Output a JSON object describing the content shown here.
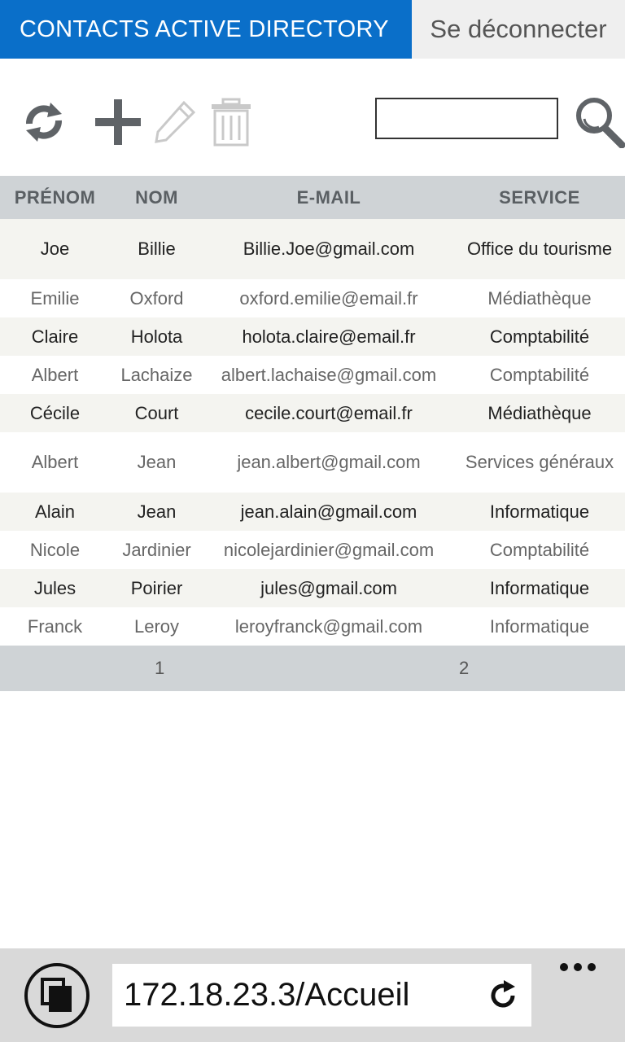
{
  "header": {
    "title": "CONTACTS ACTIVE DIRECTORY",
    "logout": "Se déconnecter"
  },
  "toolbar": {
    "search_placeholder": ""
  },
  "table": {
    "columns": [
      "PRÉNOM",
      "NOM",
      "E-MAIL",
      "SERVICE"
    ],
    "rows": [
      [
        "Joe",
        "Billie",
        "Billie.Joe@gmail.com",
        "Office du tourisme"
      ],
      [
        "Emilie",
        "Oxford",
        "oxford.emilie@email.fr",
        "Médiathèque"
      ],
      [
        "Claire",
        "Holota",
        "holota.claire@email.fr",
        "Comptabilité"
      ],
      [
        "Albert",
        "Lachaize",
        "albert.lachaise@gmail.com",
        "Comptabilité"
      ],
      [
        "Cécile",
        "Court",
        "cecile.court@email.fr",
        "Médiathèque"
      ],
      [
        "Albert",
        "Jean",
        "jean.albert@gmail.com",
        "Services généraux"
      ],
      [
        "Alain",
        "Jean",
        "jean.alain@gmail.com",
        "Informatique"
      ],
      [
        "Nicole",
        "Jardinier",
        "nicolejardinier@gmail.com",
        "Comptabilité"
      ],
      [
        "Jules",
        "Poirier",
        "jules@gmail.com",
        "Informatique"
      ],
      [
        "Franck",
        "Leroy",
        "leroyfranck@gmail.com",
        "Informatique"
      ]
    ]
  },
  "pager": {
    "pages": [
      "1",
      "2"
    ]
  },
  "browser": {
    "url": "172.18.23.3/Accueil"
  },
  "icons": {
    "refresh": "refresh-icon",
    "add": "plus-icon",
    "edit": "pencil-icon",
    "delete": "trash-icon",
    "search": "search-icon",
    "tabs": "tabs-icon",
    "reload": "reload-icon",
    "more": "more-icon"
  },
  "colors": {
    "accent": "#0a6fc9",
    "header_bg": "#cfd3d6"
  }
}
